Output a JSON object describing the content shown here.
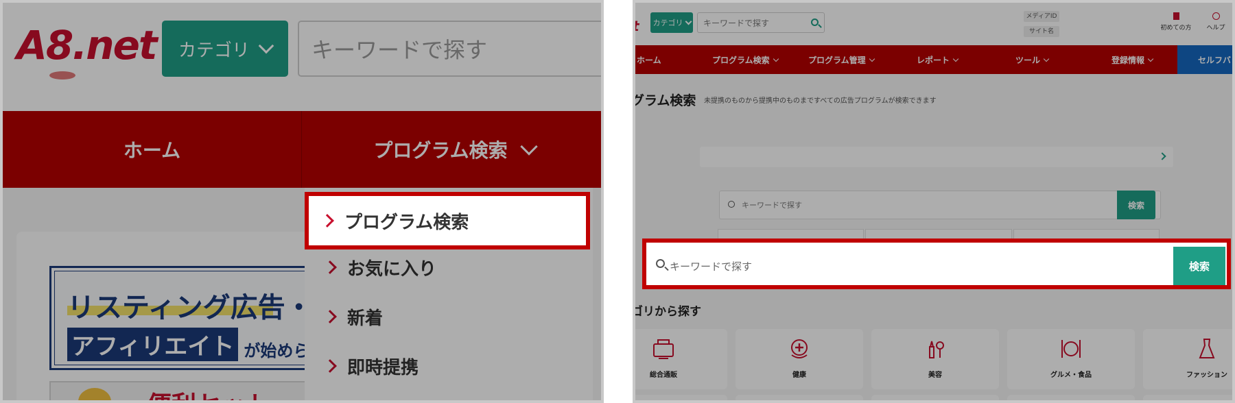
{
  "left": {
    "logo_text": "A8.net",
    "category_button": "カテゴリ",
    "keyword_placeholder": "キーワードで探す",
    "nav": {
      "home": "ホーム",
      "program_search": "プログラム検索"
    },
    "dropdown": [
      "プログラム検索",
      "お気に入り",
      "新着",
      "即時提携"
    ],
    "banner": {
      "line1": "リスティング広告・S",
      "line2a": "アフィリエイト",
      "line2b": "が始められ"
    },
    "banner2": {
      "text": "便利セット"
    }
  },
  "right": {
    "logo_text": "t",
    "category_button": "カテゴリ",
    "keyword_placeholder": "キーワードで探す",
    "media_id": "メディアID",
    "site_name": "サイト名",
    "first_time": "初めての方",
    "help": "ヘルプ",
    "nav": {
      "home": "ホーム",
      "program_search": "プログラム検索",
      "program_manage": "プログラム管理",
      "report": "レポート",
      "tools": "ツール",
      "registration": "登録情報",
      "self_back": "セルフバック"
    },
    "page_title": "グラム検索",
    "page_subtitle": "未提携のものから提携中のものまですべての広告プログラムが検索できます",
    "search_placeholder": "キーワードで探す",
    "search_button": "検索",
    "highlight_search_placeholder": "キーワードで探す",
    "highlight_search_button": "検索",
    "category_heading": "ゴリから探す",
    "categories": [
      "総合通販",
      "健康",
      "美容",
      "グルメ・食品",
      "ファッション"
    ]
  },
  "colors": {
    "brand_red": "#b50000",
    "brand_green": "#1f9e86",
    "highlight_border": "#c00000",
    "self_back_blue": "#1668c0"
  }
}
